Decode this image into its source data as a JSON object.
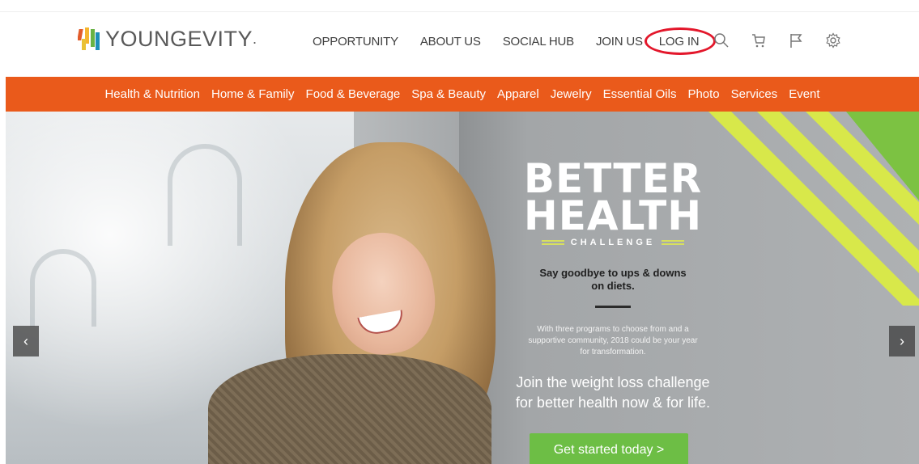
{
  "brand": {
    "name": "YOUNGEVITY",
    "mark": "."
  },
  "nav": {
    "items": [
      {
        "label": "OPPORTUNITY"
      },
      {
        "label": "ABOUT US"
      },
      {
        "label": "SOCIAL HUB"
      },
      {
        "label": "JOIN US"
      },
      {
        "label": "LOG IN"
      }
    ]
  },
  "icons": [
    "search-icon",
    "cart-icon",
    "flag-icon",
    "gear-icon"
  ],
  "categories": [
    "Health & Nutrition",
    "Home & Family",
    "Food & Beverage",
    "Spa & Beauty",
    "Apparel",
    "Jewelry",
    "Essential Oils",
    "Photo",
    "Services",
    "Event"
  ],
  "hero": {
    "title_line1": "BETTER",
    "title_line2": "HEALTH",
    "subtitle": "CHALLENGE",
    "tagline_line1": "Say goodbye to ups & downs",
    "tagline_line2": "on diets.",
    "small_line1": "With three programs to choose from and a",
    "small_line2": "supportive community, 2018 could be your year",
    "small_line3": "for transformation.",
    "join_line1": "Join the weight loss challenge",
    "join_line2": "for better health now & for life.",
    "cta": "Get started today >",
    "prev": "‹",
    "next": "›"
  },
  "colors": {
    "category_bar": "#ea5a1b",
    "cta": "#6dbe45",
    "highlight_circle": "#e3172b",
    "stripe_yellow": "#d8e84a",
    "stripe_green": "#7cc242"
  }
}
